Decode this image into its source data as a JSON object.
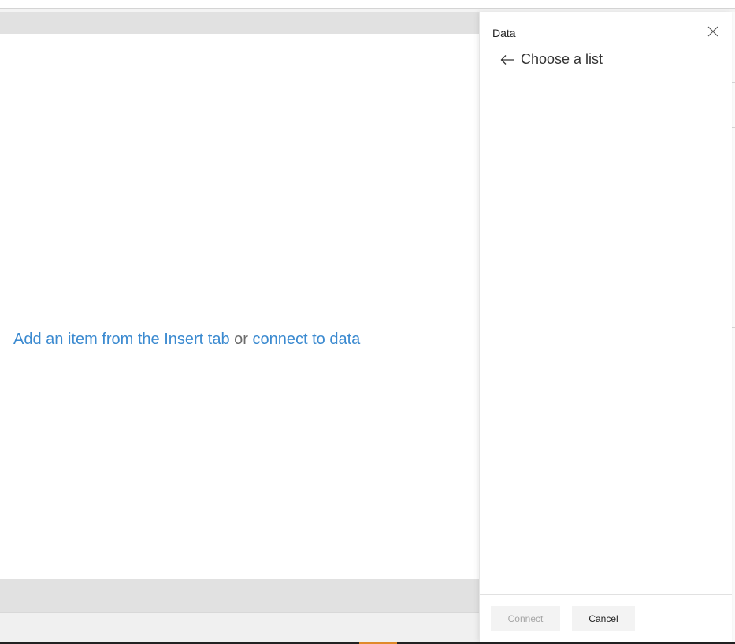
{
  "canvas": {
    "message_link1": "Add an item from the Insert tab",
    "message_or": "or",
    "message_link2": "connect to data"
  },
  "panel": {
    "title": "Data",
    "close_icon": "close-icon",
    "back_icon": "arrow-left-icon",
    "back_label": "Choose a list",
    "connect_label": "Connect",
    "cancel_label": "Cancel"
  },
  "colors": {
    "link": "#3b8ad0",
    "panel_bg": "#ffffff",
    "canvas_frame": "#e1e1e1",
    "accent": "#e08a2a"
  }
}
